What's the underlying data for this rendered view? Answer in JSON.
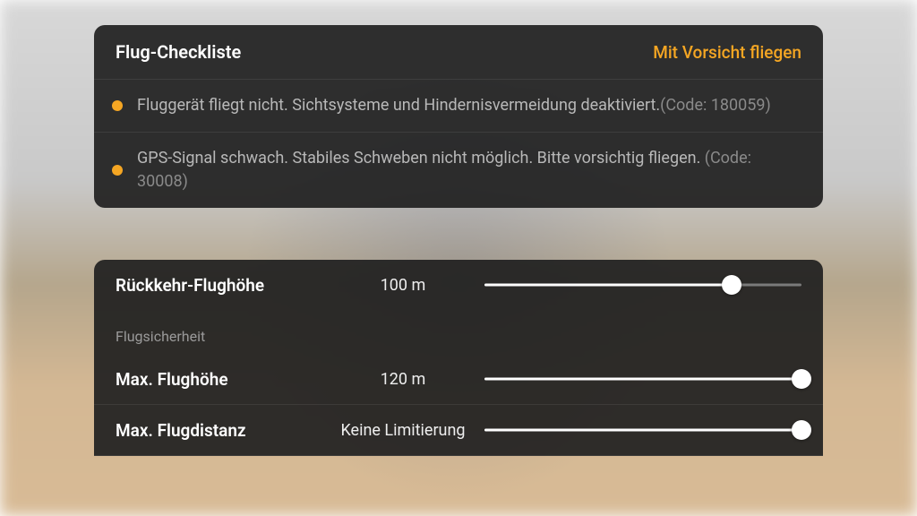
{
  "checklist": {
    "title": "Flug-Checkliste",
    "status_text": "Mit Vorsicht fliegen",
    "warnings": [
      {
        "text": "Fluggerät fliegt nicht. Sichtsysteme und Hindernisvermeidung deaktiviert.",
        "code": "(Code: 180059)"
      },
      {
        "text": "GPS-Signal schwach. Stabiles Schweben nicht möglich. Bitte vorsichtig fliegen. ",
        "code": "(Code: 30008)"
      }
    ]
  },
  "settings": {
    "rth_altitude": {
      "label": "Rückkehr-Flughöhe",
      "value": "100 m",
      "percent": 78
    },
    "section_label": "Flugsicherheit",
    "max_altitude": {
      "label": "Max. Flughöhe",
      "value": "120 m",
      "percent": 100
    },
    "max_distance": {
      "label": "Max. Flugdistanz",
      "value": "Keine Limitierung",
      "percent": 100
    }
  }
}
